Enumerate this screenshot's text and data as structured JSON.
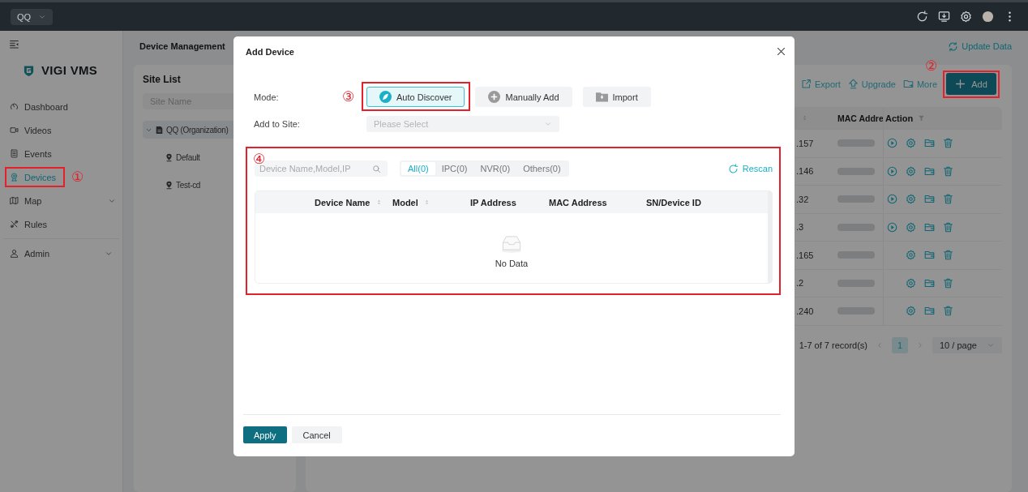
{
  "top_bar": {
    "org_selector": "QQ"
  },
  "sidebar": {
    "logo": "VIGI VMS",
    "items": [
      {
        "label": "Dashboard",
        "kind": "dashboard",
        "selected": false,
        "has_submenu": false,
        "separated": false
      },
      {
        "label": "Videos",
        "kind": "videos",
        "selected": false,
        "has_submenu": false,
        "separated": false
      },
      {
        "label": "Events",
        "kind": "events",
        "selected": false,
        "has_submenu": false,
        "separated": false
      },
      {
        "label": "Devices",
        "kind": "devices",
        "selected": true,
        "has_submenu": false,
        "separated": false,
        "callout": "①"
      },
      {
        "label": "Map",
        "kind": "map",
        "selected": false,
        "has_submenu": true,
        "separated": false
      },
      {
        "label": "Rules",
        "kind": "rules",
        "selected": false,
        "has_submenu": false,
        "separated": false
      },
      {
        "label": "Admin",
        "kind": "admin",
        "selected": false,
        "has_submenu": true,
        "separated": true
      }
    ]
  },
  "page": {
    "title": "Device Management",
    "update_link": "Update Data"
  },
  "site_list": {
    "title": "Site List",
    "search": {
      "placeholder": "Site Name"
    },
    "tree": [
      {
        "label": "QQ (Organization)",
        "kind": "organization",
        "expanded": true,
        "selected": true,
        "children": [
          {
            "label": "Default",
            "kind": "site",
            "selected": false
          },
          {
            "label": "Test-cd",
            "kind": "site",
            "selected": false
          }
        ]
      }
    ]
  },
  "device_panel": {
    "toolbar": [
      {
        "label": "Export",
        "kind": "export"
      },
      {
        "label": "Upgrade",
        "kind": "upgrade"
      },
      {
        "label": "More",
        "kind": "more"
      }
    ],
    "add_button": {
      "label": "Add",
      "callout": "②"
    },
    "columns": [
      {
        "sortable": true
      },
      {
        "label": "MAC Addre"
      },
      {
        "label": "Action",
        "filter": true
      }
    ],
    "rows": [
      {
        "column_1": ".157",
        "mac_redacted": true,
        "actions": [
          {
            "kind": "play"
          },
          {
            "kind": "settings"
          },
          {
            "kind": "folder"
          },
          {
            "kind": "delete"
          }
        ]
      },
      {
        "column_1": ".146",
        "mac_redacted": true,
        "actions": [
          {
            "kind": "play"
          },
          {
            "kind": "settings"
          },
          {
            "kind": "folder"
          },
          {
            "kind": "delete"
          }
        ]
      },
      {
        "column_1": ".32",
        "mac_redacted": true,
        "actions": [
          {
            "kind": "play"
          },
          {
            "kind": "settings"
          },
          {
            "kind": "folder"
          },
          {
            "kind": "delete"
          }
        ]
      },
      {
        "column_1": ".3",
        "mac_redacted": true,
        "actions": [
          {
            "kind": "play"
          },
          {
            "kind": "settings"
          },
          {
            "kind": "folder"
          },
          {
            "kind": "delete"
          }
        ]
      },
      {
        "column_1": ".165",
        "mac_redacted": true,
        "actions": [
          {
            "kind": "settings"
          },
          {
            "kind": "folder"
          },
          {
            "kind": "delete"
          }
        ]
      },
      {
        "column_1": ".2",
        "mac_redacted": true,
        "actions": [
          {
            "kind": "settings"
          },
          {
            "kind": "folder"
          },
          {
            "kind": "delete"
          }
        ]
      },
      {
        "column_1": ".240",
        "mac_redacted": true,
        "actions": [
          {
            "kind": "settings"
          },
          {
            "kind": "folder"
          },
          {
            "kind": "delete"
          }
        ]
      }
    ],
    "pagination": {
      "summary": "1-7 of 7 record(s)",
      "pages": [
        {
          "label": "1",
          "selected": true
        }
      ],
      "page_size": "10 / page"
    }
  },
  "modal": {
    "title": "Add Device",
    "mode_label": "Mode:",
    "modes": [
      {
        "label": "Auto Discover",
        "kind": "discover",
        "selected": true,
        "callout": "③"
      },
      {
        "label": "Manually Add",
        "kind": "manual",
        "selected": false
      },
      {
        "label": "Import",
        "kind": "import",
        "selected": false
      }
    ],
    "site_label": "Add to Site:",
    "site_select": {
      "placeholder": "Please Select"
    },
    "discovery": {
      "callout": "④",
      "search": {
        "placeholder": "Device Name,Model,IP"
      },
      "filters": [
        {
          "label": "All(0)",
          "selected": true
        },
        {
          "label": "IPC(0)",
          "selected": false
        },
        {
          "label": "NVR(0)",
          "selected": false
        },
        {
          "label": "Others(0)",
          "selected": false
        }
      ],
      "rescan": "Rescan",
      "columns": [
        {
          "label": "Device Name",
          "sortable": true
        },
        {
          "label": "Model",
          "sortable": true
        },
        {
          "label": "IP Address",
          "sortable": false
        },
        {
          "label": "MAC Address",
          "sortable": false
        },
        {
          "label": "SN/Device ID",
          "sortable": false
        }
      ],
      "empty_text": "No Data"
    },
    "buttons": [
      {
        "label": "Apply",
        "kind": "primary"
      },
      {
        "label": "Cancel",
        "kind": "secondary"
      }
    ]
  }
}
